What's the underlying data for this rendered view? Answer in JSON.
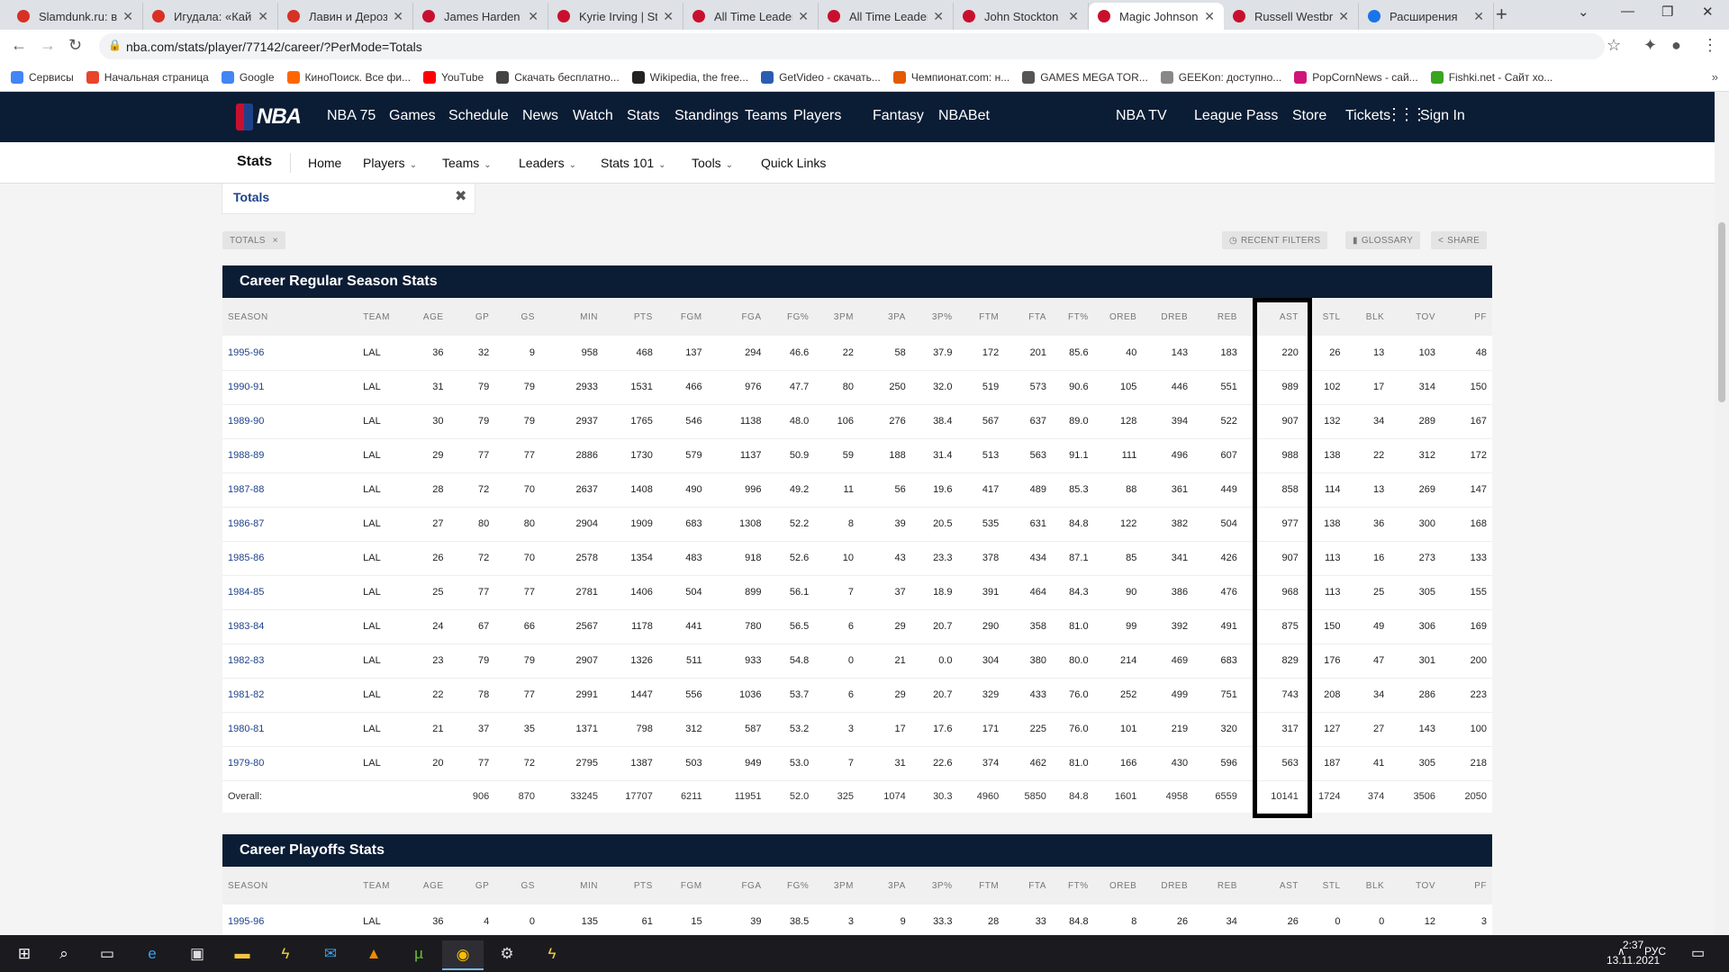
{
  "browser": {
    "tabs": [
      {
        "title": "Slamdunk.ru: вс",
        "fav": "y",
        "color": "#d93025",
        "active": false
      },
      {
        "title": "Игудала: «Кайр",
        "fav": "y",
        "color": "#d93025",
        "active": false
      },
      {
        "title": "Лавин и Дероза",
        "fav": "y",
        "color": "#d93025",
        "active": false
      },
      {
        "title": "James Harden |",
        "fav": "nba",
        "color": "#c8102e",
        "active": false
      },
      {
        "title": "Kyrie Irving | Sta",
        "fav": "nba",
        "color": "#c8102e",
        "active": false
      },
      {
        "title": "All Time Leader",
        "fav": "nba",
        "color": "#c8102e",
        "active": false
      },
      {
        "title": "All Time Leader",
        "fav": "nba",
        "color": "#c8102e",
        "active": false
      },
      {
        "title": "John Stockton |",
        "fav": "nba",
        "color": "#c8102e",
        "active": false
      },
      {
        "title": "Magic Johnson",
        "fav": "nba",
        "color": "#c8102e",
        "active": true
      },
      {
        "title": "Russell Westbro",
        "fav": "nba",
        "color": "#c8102e",
        "active": false
      },
      {
        "title": "Расширения",
        "fav": "puzzle",
        "color": "#1a73e8",
        "active": false
      }
    ],
    "new_tab": "+",
    "url": "nba.com/stats/player/77142/career/?PerMode=Totals",
    "bookmarks": [
      {
        "label": "Сервисы",
        "icon": "grid-icon",
        "color": "#4285f4"
      },
      {
        "label": "Начальная страница",
        "icon": "yandex-icon",
        "color": "#e8452c"
      },
      {
        "label": "Google",
        "icon": "google-icon",
        "color": "#4285f4"
      },
      {
        "label": "КиноПоиск. Все фи...",
        "icon": "kinopoisk-icon",
        "color": "#f60"
      },
      {
        "label": "YouTube",
        "icon": "youtube-icon",
        "color": "#f00"
      },
      {
        "label": "Скачать бесплатно...",
        "icon": "download-icon",
        "color": "#444"
      },
      {
        "label": "Wikipedia, the free...",
        "icon": "wikipedia-icon",
        "color": "#222"
      },
      {
        "label": "GetVideo - скачать...",
        "icon": "getvideo-icon",
        "color": "#2a5db0"
      },
      {
        "label": "Чемпионат.com: н...",
        "icon": "championat-icon",
        "color": "#e35a00"
      },
      {
        "label": "GAMES MEGA TOR...",
        "icon": "gamepad-icon",
        "color": "#555"
      },
      {
        "label": "GEEKon: доступно...",
        "icon": "geekon-icon",
        "color": "#888"
      },
      {
        "label": "PopCornNews - сай...",
        "icon": "popcorn-icon",
        "color": "#d0157a"
      },
      {
        "label": "Fishki.net - Сайт хо...",
        "icon": "fishki-icon",
        "color": "#3aa520"
      }
    ]
  },
  "nba": {
    "logo": "NBA",
    "nav_left": [
      "NBA 75",
      "Games",
      "Schedule",
      "News",
      "Watch",
      "Stats",
      "Standings",
      "Teams",
      "Players",
      "Fantasy",
      "NBABet"
    ],
    "nav_right": [
      "NBA TV",
      "League Pass",
      "Store",
      "Tickets"
    ],
    "sign_in": "Sign In"
  },
  "subnav": {
    "brand": "Stats",
    "items": [
      {
        "label": "Home",
        "dropdown": false
      },
      {
        "label": "Players",
        "dropdown": true
      },
      {
        "label": "Teams",
        "dropdown": true
      },
      {
        "label": "Leaders",
        "dropdown": true
      },
      {
        "label": "Stats 101",
        "dropdown": true
      },
      {
        "label": "Tools",
        "dropdown": true
      },
      {
        "label": "Quick Links",
        "dropdown": false
      }
    ]
  },
  "filter": {
    "label": "Totals"
  },
  "chips": {
    "totals": "TOTALS",
    "recent": "RECENT FILTERS",
    "glossary": "GLOSSARY",
    "share": "SHARE"
  },
  "columns": [
    "SEASON",
    "TEAM",
    "AGE",
    "GP",
    "GS",
    "MIN",
    "PTS",
    "FGM",
    "FGA",
    "FG%",
    "3PM",
    "3PA",
    "3P%",
    "FTM",
    "FTA",
    "FT%",
    "OREB",
    "DREB",
    "REB",
    "AST",
    "STL",
    "BLK",
    "TOV",
    "PF"
  ],
  "regular": {
    "title": "Career Regular Season Stats",
    "rows": [
      [
        "1995-96",
        "LAL",
        "36",
        "32",
        "9",
        "958",
        "468",
        "137",
        "294",
        "46.6",
        "22",
        "58",
        "37.9",
        "172",
        "201",
        "85.6",
        "40",
        "143",
        "183",
        "220",
        "26",
        "13",
        "103",
        "48"
      ],
      [
        "1990-91",
        "LAL",
        "31",
        "79",
        "79",
        "2933",
        "1531",
        "466",
        "976",
        "47.7",
        "80",
        "250",
        "32.0",
        "519",
        "573",
        "90.6",
        "105",
        "446",
        "551",
        "989",
        "102",
        "17",
        "314",
        "150"
      ],
      [
        "1989-90",
        "LAL",
        "30",
        "79",
        "79",
        "2937",
        "1765",
        "546",
        "1138",
        "48.0",
        "106",
        "276",
        "38.4",
        "567",
        "637",
        "89.0",
        "128",
        "394",
        "522",
        "907",
        "132",
        "34",
        "289",
        "167"
      ],
      [
        "1988-89",
        "LAL",
        "29",
        "77",
        "77",
        "2886",
        "1730",
        "579",
        "1137",
        "50.9",
        "59",
        "188",
        "31.4",
        "513",
        "563",
        "91.1",
        "111",
        "496",
        "607",
        "988",
        "138",
        "22",
        "312",
        "172"
      ],
      [
        "1987-88",
        "LAL",
        "28",
        "72",
        "70",
        "2637",
        "1408",
        "490",
        "996",
        "49.2",
        "11",
        "56",
        "19.6",
        "417",
        "489",
        "85.3",
        "88",
        "361",
        "449",
        "858",
        "114",
        "13",
        "269",
        "147"
      ],
      [
        "1986-87",
        "LAL",
        "27",
        "80",
        "80",
        "2904",
        "1909",
        "683",
        "1308",
        "52.2",
        "8",
        "39",
        "20.5",
        "535",
        "631",
        "84.8",
        "122",
        "382",
        "504",
        "977",
        "138",
        "36",
        "300",
        "168"
      ],
      [
        "1985-86",
        "LAL",
        "26",
        "72",
        "70",
        "2578",
        "1354",
        "483",
        "918",
        "52.6",
        "10",
        "43",
        "23.3",
        "378",
        "434",
        "87.1",
        "85",
        "341",
        "426",
        "907",
        "113",
        "16",
        "273",
        "133"
      ],
      [
        "1984-85",
        "LAL",
        "25",
        "77",
        "77",
        "2781",
        "1406",
        "504",
        "899",
        "56.1",
        "7",
        "37",
        "18.9",
        "391",
        "464",
        "84.3",
        "90",
        "386",
        "476",
        "968",
        "113",
        "25",
        "305",
        "155"
      ],
      [
        "1983-84",
        "LAL",
        "24",
        "67",
        "66",
        "2567",
        "1178",
        "441",
        "780",
        "56.5",
        "6",
        "29",
        "20.7",
        "290",
        "358",
        "81.0",
        "99",
        "392",
        "491",
        "875",
        "150",
        "49",
        "306",
        "169"
      ],
      [
        "1982-83",
        "LAL",
        "23",
        "79",
        "79",
        "2907",
        "1326",
        "511",
        "933",
        "54.8",
        "0",
        "21",
        "0.0",
        "304",
        "380",
        "80.0",
        "214",
        "469",
        "683",
        "829",
        "176",
        "47",
        "301",
        "200"
      ],
      [
        "1981-82",
        "LAL",
        "22",
        "78",
        "77",
        "2991",
        "1447",
        "556",
        "1036",
        "53.7",
        "6",
        "29",
        "20.7",
        "329",
        "433",
        "76.0",
        "252",
        "499",
        "751",
        "743",
        "208",
        "34",
        "286",
        "223"
      ],
      [
        "1980-81",
        "LAL",
        "21",
        "37",
        "35",
        "1371",
        "798",
        "312",
        "587",
        "53.2",
        "3",
        "17",
        "17.6",
        "171",
        "225",
        "76.0",
        "101",
        "219",
        "320",
        "317",
        "127",
        "27",
        "143",
        "100"
      ],
      [
        "1979-80",
        "LAL",
        "20",
        "77",
        "72",
        "2795",
        "1387",
        "503",
        "949",
        "53.0",
        "7",
        "31",
        "22.6",
        "374",
        "462",
        "81.0",
        "166",
        "430",
        "596",
        "563",
        "187",
        "41",
        "305",
        "218"
      ]
    ],
    "total": [
      "Overall:",
      "",
      "",
      "906",
      "870",
      "33245",
      "17707",
      "6211",
      "11951",
      "52.0",
      "325",
      "1074",
      "30.3",
      "4960",
      "5850",
      "84.8",
      "1601",
      "4958",
      "6559",
      "10141",
      "1724",
      "374",
      "3506",
      "2050"
    ]
  },
  "playoffs": {
    "title": "Career Playoffs Stats",
    "rows": [
      [
        "1995-96",
        "LAL",
        "36",
        "4",
        "0",
        "135",
        "61",
        "15",
        "39",
        "38.5",
        "3",
        "9",
        "33.3",
        "28",
        "33",
        "84.8",
        "8",
        "26",
        "34",
        "26",
        "0",
        "0",
        "12",
        "3"
      ]
    ]
  },
  "taskbar": {
    "lang": "РУС",
    "time": "2:37",
    "date": "13.11.2021"
  }
}
